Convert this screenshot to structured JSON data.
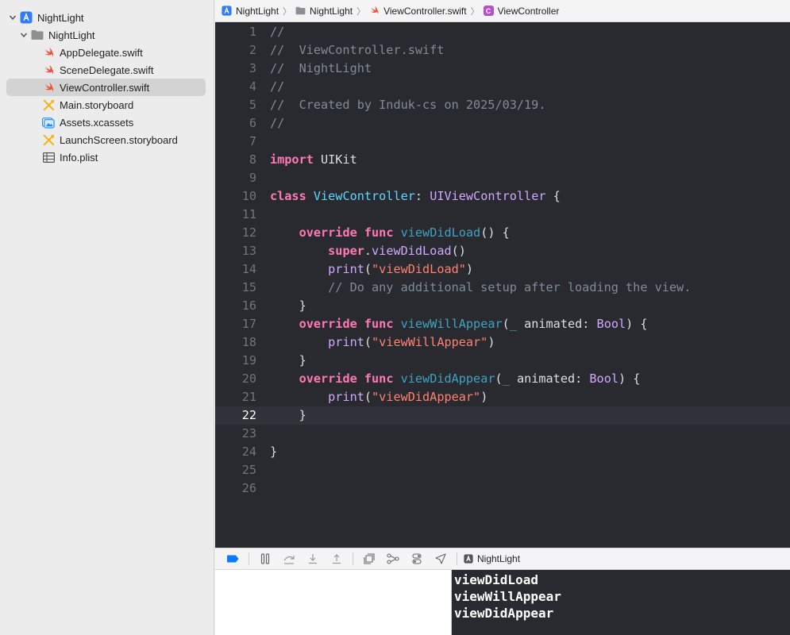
{
  "navigator": {
    "project_name": "NightLight",
    "group_name": "NightLight",
    "files": [
      {
        "name": "AppDelegate.swift",
        "icon": "swift-file-icon"
      },
      {
        "name": "SceneDelegate.swift",
        "icon": "swift-file-icon"
      },
      {
        "name": "ViewController.swift",
        "icon": "swift-file-icon",
        "selected": true
      },
      {
        "name": "Main.storyboard",
        "icon": "storyboard-icon"
      },
      {
        "name": "Assets.xcassets",
        "icon": "asset-catalog-icon"
      },
      {
        "name": "LaunchScreen.storyboard",
        "icon": "storyboard-icon"
      },
      {
        "name": "Info.plist",
        "icon": "plist-icon"
      }
    ]
  },
  "jumpbar": {
    "project": "NightLight",
    "group": "NightLight",
    "file": "ViewController.swift",
    "symbol": "ViewController",
    "symbol_badge": "C"
  },
  "editor": {
    "current_line": 22,
    "line_numbers": [
      "1",
      "2",
      "3",
      "4",
      "5",
      "6",
      "7",
      "8",
      "9",
      "10",
      "11",
      "12",
      "13",
      "14",
      "15",
      "16",
      "17",
      "18",
      "19",
      "20",
      "21",
      "22",
      "23",
      "24",
      "25",
      "26"
    ],
    "lines": [
      [
        {
          "t": "//",
          "c": "cmt"
        }
      ],
      [
        {
          "t": "//  ViewController.swift",
          "c": "cmt"
        }
      ],
      [
        {
          "t": "//  NightLight",
          "c": "cmt"
        }
      ],
      [
        {
          "t": "//",
          "c": "cmt"
        }
      ],
      [
        {
          "t": "//  Created by Induk-cs on 2025/03/19.",
          "c": "cmt"
        }
      ],
      [
        {
          "t": "//",
          "c": "cmt"
        }
      ],
      [],
      [
        {
          "t": "import",
          "c": "kw"
        },
        {
          "t": " UIKit",
          "c": "plain"
        }
      ],
      [],
      [
        {
          "t": "class",
          "c": "kw"
        },
        {
          "t": " ",
          "c": "plain"
        },
        {
          "t": "ViewController",
          "c": "tname"
        },
        {
          "t": ": ",
          "c": "plain"
        },
        {
          "t": "UIViewController",
          "c": "ptype"
        },
        {
          "t": " {",
          "c": "plain"
        }
      ],
      [],
      [
        {
          "t": "    ",
          "c": "plain"
        },
        {
          "t": "override",
          "c": "kw"
        },
        {
          "t": " ",
          "c": "plain"
        },
        {
          "t": "func",
          "c": "kw"
        },
        {
          "t": " ",
          "c": "plain"
        },
        {
          "t": "viewDidLoad",
          "c": "func"
        },
        {
          "t": "() {",
          "c": "plain"
        }
      ],
      [
        {
          "t": "        ",
          "c": "plain"
        },
        {
          "t": "super",
          "c": "kw"
        },
        {
          "t": ".",
          "c": "plain"
        },
        {
          "t": "viewDidLoad",
          "c": "ptype"
        },
        {
          "t": "()",
          "c": "plain"
        }
      ],
      [
        {
          "t": "        ",
          "c": "plain"
        },
        {
          "t": "print",
          "c": "ptype"
        },
        {
          "t": "(",
          "c": "plain"
        },
        {
          "t": "\"viewDidLoad\"",
          "c": "str"
        },
        {
          "t": ")",
          "c": "plain"
        }
      ],
      [
        {
          "t": "        // Do any additional setup after loading the view.",
          "c": "cmt"
        }
      ],
      [
        {
          "t": "    }",
          "c": "plain"
        }
      ],
      [
        {
          "t": "    ",
          "c": "plain"
        },
        {
          "t": "override",
          "c": "kw"
        },
        {
          "t": " ",
          "c": "plain"
        },
        {
          "t": "func",
          "c": "kw"
        },
        {
          "t": " ",
          "c": "plain"
        },
        {
          "t": "viewWillAppear",
          "c": "func"
        },
        {
          "t": "(",
          "c": "plain"
        },
        {
          "t": "_",
          "c": "func"
        },
        {
          "t": " animated: ",
          "c": "plain"
        },
        {
          "t": "Bool",
          "c": "ptype"
        },
        {
          "t": ") {",
          "c": "plain"
        }
      ],
      [
        {
          "t": "        ",
          "c": "plain"
        },
        {
          "t": "print",
          "c": "ptype"
        },
        {
          "t": "(",
          "c": "plain"
        },
        {
          "t": "\"viewWillAppear\"",
          "c": "str"
        },
        {
          "t": ")",
          "c": "plain"
        }
      ],
      [
        {
          "t": "    }",
          "c": "plain"
        }
      ],
      [
        {
          "t": "    ",
          "c": "plain"
        },
        {
          "t": "override",
          "c": "kw"
        },
        {
          "t": " ",
          "c": "plain"
        },
        {
          "t": "func",
          "c": "kw"
        },
        {
          "t": " ",
          "c": "plain"
        },
        {
          "t": "viewDidAppear",
          "c": "func"
        },
        {
          "t": "(",
          "c": "plain"
        },
        {
          "t": "_",
          "c": "func"
        },
        {
          "t": " animated: ",
          "c": "plain"
        },
        {
          "t": "Bool",
          "c": "ptype"
        },
        {
          "t": ") {",
          "c": "plain"
        }
      ],
      [
        {
          "t": "        ",
          "c": "plain"
        },
        {
          "t": "print",
          "c": "ptype"
        },
        {
          "t": "(",
          "c": "plain"
        },
        {
          "t": "\"viewDidAppear\"",
          "c": "str"
        },
        {
          "t": ")",
          "c": "plain"
        }
      ],
      [
        {
          "t": "    }",
          "c": "plain"
        }
      ],
      [],
      [
        {
          "t": "}",
          "c": "plain"
        }
      ],
      [],
      []
    ]
  },
  "debugbar": {
    "target": "NightLight"
  },
  "console": {
    "lines": [
      "viewDidLoad",
      "viewWillAppear",
      "viewDidAppear"
    ]
  },
  "colors": {
    "editor_bg": "#292a30",
    "keyword": "#ff7ab2",
    "type_decl": "#5dd8ff",
    "type_ref": "#d0a8ff",
    "function_decl": "#41a1c0",
    "string": "#ff8170",
    "comment": "#7f8c98",
    "swift_orange": "#f05138"
  }
}
